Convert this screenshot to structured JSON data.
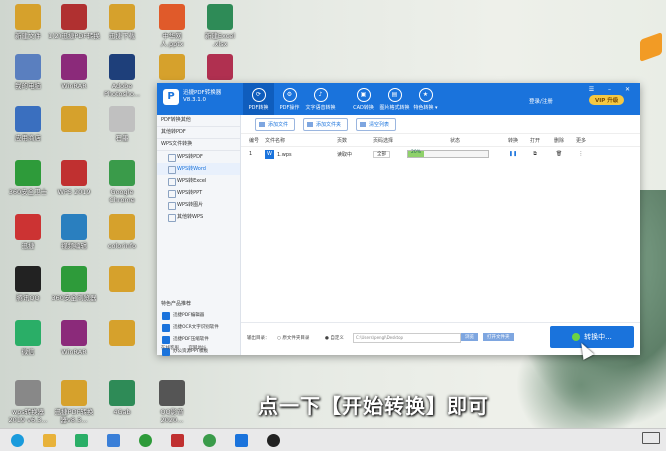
{
  "desktop": {
    "icons": [
      {
        "label": "新建文件",
        "color": "#d6a12c"
      },
      {
        "label": "1(2)迅捷PDF转换",
        "color": "#b03030"
      },
      {
        "label": "迅捷下载",
        "color": "#d6a12c"
      },
      {
        "label": "中华网\n人.pptx",
        "color": "#e05a2a"
      },
      {
        "label": "新建Excel\n.xlsx",
        "color": "#2e8b57"
      },
      {
        "label": "我的电脑",
        "color": "#5a7fbf"
      },
      {
        "label": "WinRAR",
        "color": "#8b2a7a"
      },
      {
        "label": "Adobe\nPhotosho...",
        "color": "#1e3f7a"
      },
      {
        "label": "",
        "color": "#d6a12c"
      },
      {
        "label": "",
        "color": "#b03050"
      },
      {
        "label": "应用商店",
        "color": "#3a6fbf"
      },
      {
        "label": "",
        "color": "#d6a12c"
      },
      {
        "label": "石墨",
        "color": "#c0c0c0"
      },
      {
        "label": "360安全卫士",
        "color": "#2e9b3a"
      },
      {
        "label": "WPS 2019",
        "color": "#c03030"
      },
      {
        "label": "Google\nChrome",
        "color": "#3a9b4a"
      },
      {
        "label": "迅捷",
        "color": "#cc3333"
      },
      {
        "label": "视频编辑",
        "color": "#2a7fbf"
      },
      {
        "label": "colorinfo",
        "color": "#d6a12c"
      },
      {
        "label": "腾讯QQ",
        "color": "#222222"
      },
      {
        "label": "360安全浏览器",
        "color": "#2e9b3a"
      },
      {
        "label": "",
        "color": "#d6a12c"
      },
      {
        "label": "微信",
        "color": "#2aae67"
      },
      {
        "label": "WinRAR",
        "color": "#8b2a7a"
      },
      {
        "label": "",
        "color": "#d6a12c"
      },
      {
        "label": "wps转换器\n2019 v6.3...",
        "color": "#888888"
      },
      {
        "label": "迅捷PDF转换\n器v8.3...",
        "color": "#d6a12c"
      },
      {
        "label": "4Gab",
        "color": "#2e8b57"
      },
      {
        "label": "QQ影音\n2020...",
        "color": "#555555"
      }
    ]
  },
  "app": {
    "title_line1": "迅捷PDF转换器",
    "title_line2": "V8.3.1.0",
    "logo_letter": "P",
    "tabs": [
      {
        "label": "PDF转换",
        "icon": "⟳",
        "active": true
      },
      {
        "label": "PDF操作",
        "icon": "⚙",
        "active": false
      },
      {
        "label": "文字语音转换",
        "icon": "♪",
        "active": false
      },
      {
        "label": "CAD转换",
        "icon": "▣",
        "active": false
      },
      {
        "label": "图片格式转换",
        "icon": "▤",
        "active": false
      },
      {
        "label": "特色转换 ▾",
        "icon": "★",
        "active": false
      }
    ],
    "login": "登录/注册",
    "vip": "VIP 升级",
    "window_controls": "☰ – ✕",
    "sidebar": {
      "sections": [
        "PDF转换其他",
        "其他转PDF",
        "WPS文件转换"
      ],
      "items": [
        {
          "label": "WPS转PDF",
          "selected": false
        },
        {
          "label": "WPS转Word",
          "selected": true
        },
        {
          "label": "WPS转Excel",
          "selected": false
        },
        {
          "label": "WPS转PPT",
          "selected": false
        },
        {
          "label": "WPS转图片",
          "selected": false
        },
        {
          "label": "其他转WPS",
          "selected": false
        }
      ],
      "recommend_title": "特色产品推荐",
      "recommend": [
        "迅捷PDF编辑器",
        "迅捷OCR文字识别软件",
        "迅捷PDF压缩软件",
        "办公资源PPT模板"
      ],
      "footer": [
        "在线客服",
        "官网地址"
      ]
    },
    "toolbar": {
      "add_file": "添加文件",
      "add_folder": "添加文件夹",
      "clear": "清空列表"
    },
    "table": {
      "headers": [
        "编号",
        "文件名称",
        "页数",
        "页码选择",
        "状态",
        "转换",
        "打开",
        "删除",
        "更多"
      ],
      "rows": [
        {
          "num": "1",
          "name": "1.wps",
          "pages": "读取中",
          "pagesel": "全部",
          "progress_text": "20%",
          "progress": 0.2,
          "convert": "❚❚",
          "open": "⧉",
          "delete": "🗑",
          "more": "⋮"
        }
      ]
    },
    "bottom": {
      "output_label": "输出目录：",
      "opt_original": "原文件夹目录",
      "opt_custom": "自定义",
      "path": "C:\\Users\\pengl\\Desktop",
      "browse": "浏览",
      "open_folder": "打开文件夹",
      "convert_label": "转换中..."
    }
  },
  "caption": "点一下【开始转换】即可",
  "taskbar": {
    "items": [
      {
        "name": "windows",
        "color": "#1a9bdc"
      },
      {
        "name": "explorer",
        "color": "#e8b23a"
      },
      {
        "name": "store",
        "color": "#2aae67"
      },
      {
        "name": "baidu",
        "color": "#3a7fd8"
      },
      {
        "name": "360",
        "color": "#2e9b3a"
      },
      {
        "name": "wps",
        "color": "#c03030"
      },
      {
        "name": "chrome",
        "color": "#3a9b4a"
      },
      {
        "name": "pdf",
        "color": "#1a73dc"
      },
      {
        "name": "record",
        "color": "#222222"
      }
    ]
  }
}
